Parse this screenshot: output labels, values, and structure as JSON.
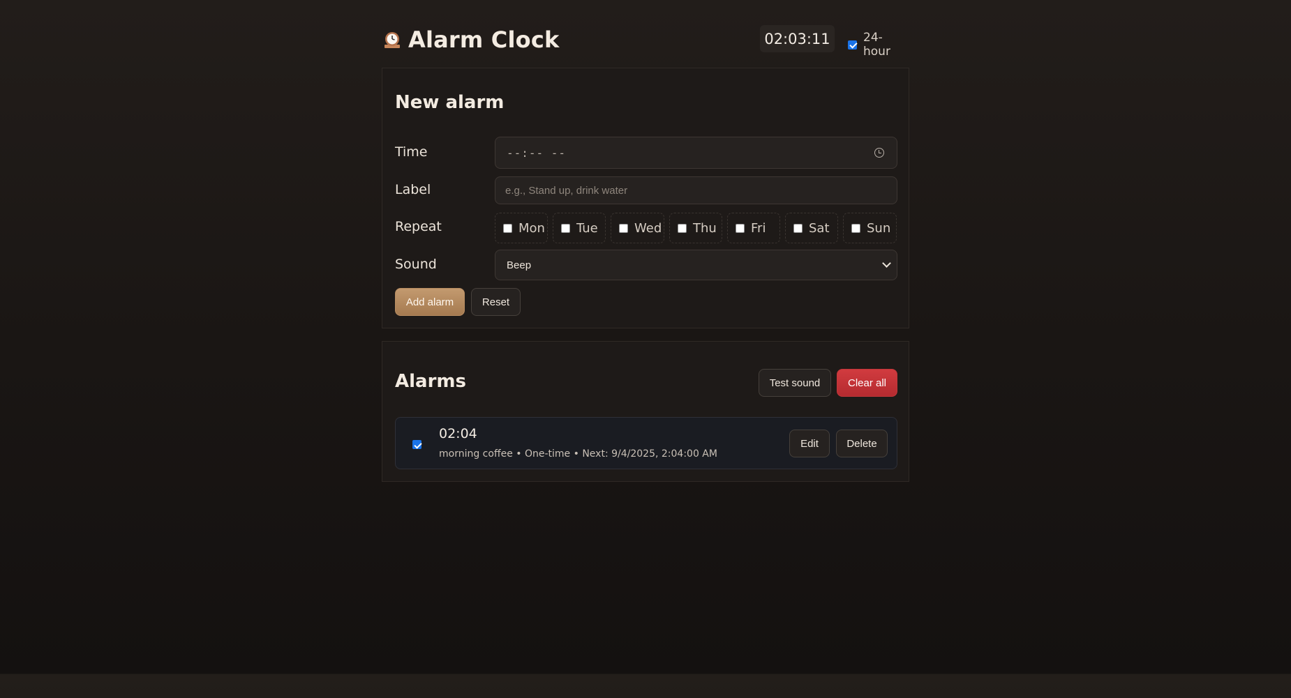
{
  "header": {
    "title": "Alarm Clock",
    "icon": "mantel-clock-icon",
    "current_time": "02:03:11",
    "hour_format_label": "24-hour",
    "hour_format_checked": true
  },
  "new_alarm": {
    "heading": "New alarm",
    "time_label": "Time",
    "time_value": "--:-- --",
    "label_label": "Label",
    "label_placeholder": "e.g., Stand up, drink water",
    "repeat_label": "Repeat",
    "days": [
      "Mon",
      "Tue",
      "Wed",
      "Thu",
      "Fri",
      "Sat",
      "Sun"
    ],
    "sound_label": "Sound",
    "sound_value": "Beep",
    "add_button": "Add alarm",
    "reset_button": "Reset"
  },
  "alarms": {
    "heading": "Alarms",
    "test_sound_button": "Test sound",
    "clear_all_button": "Clear all",
    "items": [
      {
        "enabled": true,
        "time": "02:04",
        "meta": "morning coffee • One-time • Next: 9/4/2025, 2:04:00 AM",
        "edit_button": "Edit",
        "delete_button": "Delete"
      }
    ]
  },
  "colors": {
    "accent": "#b88d62",
    "danger": "#c2363a",
    "checkbox": "#1a73e8"
  }
}
